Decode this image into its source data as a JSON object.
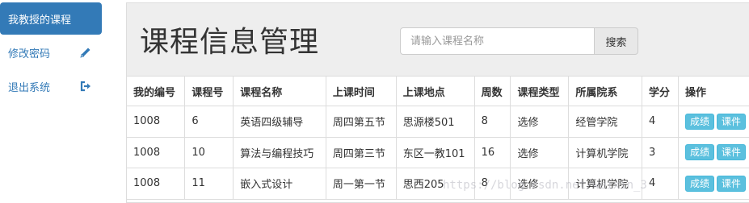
{
  "sidebar": {
    "items": [
      {
        "label": "我教授的课程",
        "active": true
      },
      {
        "label": "修改密码",
        "icon": "pencil-icon"
      },
      {
        "label": "退出系统",
        "icon": "log-out-icon"
      }
    ]
  },
  "header": {
    "title": "课程信息管理",
    "search_placeholder": "请输入课程名称",
    "search_button": "搜索"
  },
  "table": {
    "columns": [
      "我的编号",
      "课程号",
      "课程名称",
      "上课时间",
      "上课地点",
      "周数",
      "课程类型",
      "所属院系",
      "学分",
      "操作"
    ],
    "rows": [
      [
        "1008",
        "6",
        "英语四级辅导",
        "周四第五节",
        "思源楼501",
        "8",
        "选修",
        "经管学院",
        "4"
      ],
      [
        "1008",
        "10",
        "算法与编程技巧",
        "周四第三节",
        "东区一教101",
        "16",
        "选修",
        "计算机学院",
        "3"
      ],
      [
        "1008",
        "11",
        "嵌入式设计",
        "周一第一节",
        "思西205",
        "8",
        "选修",
        "计算机学院",
        "4"
      ]
    ],
    "actions": {
      "grades": "成绩",
      "courseware": "课件"
    }
  },
  "watermark": "https://blog.csdn.net/weixin_3",
  "colors": {
    "primary": "#337ab7",
    "info": "#5bc0de",
    "jumbotron": "#eeeeee"
  }
}
